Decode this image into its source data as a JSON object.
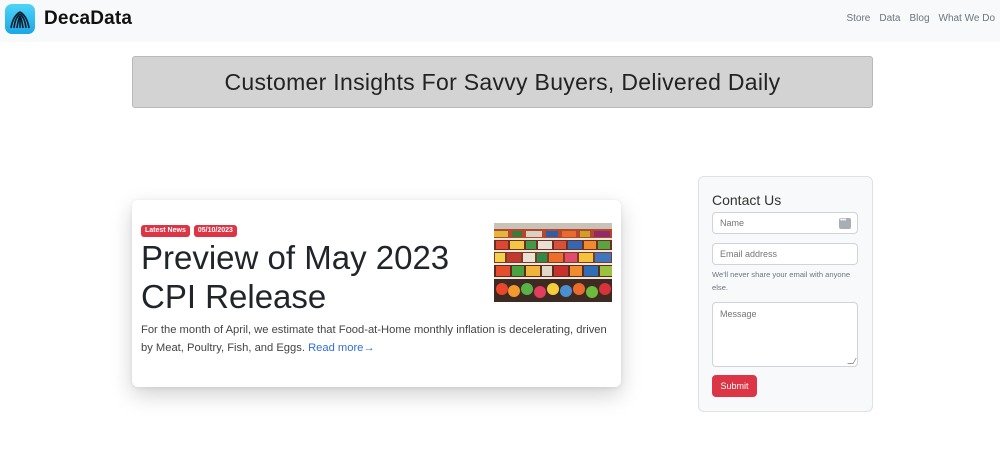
{
  "navbar": {
    "brand": "DecaData",
    "links": [
      "Store",
      "Data",
      "Blog",
      "What We Do"
    ]
  },
  "banner": {
    "text": "Customer Insights For Savvy Buyers, Delivered Daily"
  },
  "article": {
    "badges": [
      "Latest News",
      "05/10/2023"
    ],
    "title": "Preview of May 2023 CPI Release",
    "body": "For the month of April, we estimate that Food-at-Home monthly inflation is decelerating, driven by Meat, Poultry, Fish, and Eggs. ",
    "read_more": "Read more→"
  },
  "contact": {
    "title": "Contact Us",
    "name_placeholder": "Name",
    "email_placeholder": "Email address",
    "email_help": "We'll never share your email with anyone else.",
    "message_placeholder": "Message",
    "submit_label": "Submit"
  },
  "colors": {
    "accent": "#dc3545",
    "link": "#2f6fd6",
    "banner_bg": "#d3d3d3",
    "navbar_bg": "#f8f9fa",
    "logo": "#1aa7e6"
  }
}
